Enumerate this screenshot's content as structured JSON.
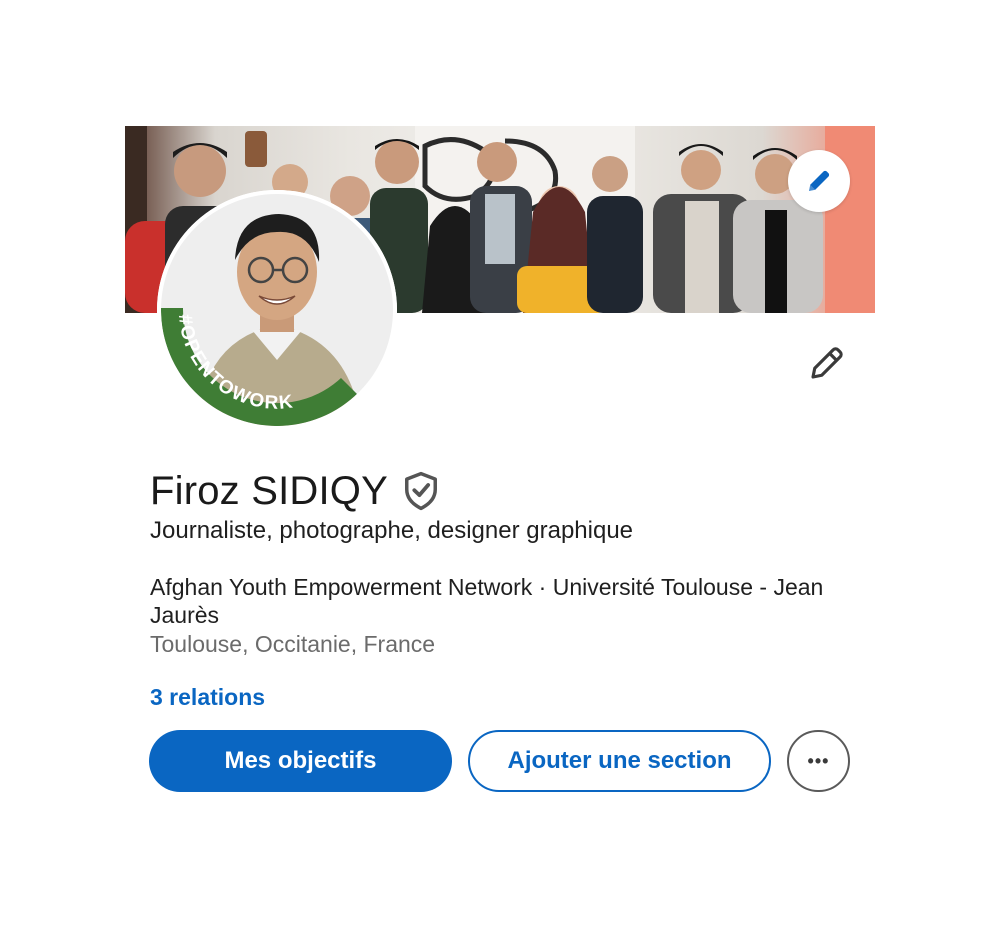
{
  "profile": {
    "name": "Firoz SIDIQY",
    "headline": "Journaliste, photographe, designer graphique",
    "organization": "Afghan Youth Empowerment Network · Université Toulouse - Jean Jaurès",
    "location": "Toulouse, Occitanie, France",
    "relations": "3 relations",
    "frame_text": "#OPENTOWORK"
  },
  "actions": {
    "primary_label": "Mes objectifs",
    "secondary_label": "Ajouter une section",
    "more_label": "•••"
  },
  "icons": {
    "cover_edit": "pencil-icon",
    "profile_edit": "pencil-icon",
    "verified": "shield-check-icon",
    "more": "more-horizontal-icon"
  },
  "colors": {
    "accent": "#0a66c2",
    "open_to_work": "#3f7d35",
    "text_primary": "#1a1a1a",
    "text_secondary": "#6b6b6b"
  }
}
